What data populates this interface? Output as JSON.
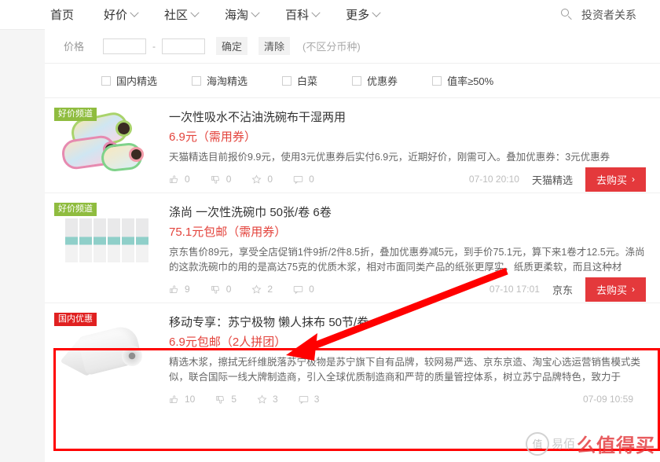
{
  "nav": {
    "items": [
      {
        "label": "首页",
        "caret": false
      },
      {
        "label": "好价",
        "caret": true
      },
      {
        "label": "社区",
        "caret": true
      },
      {
        "label": "海淘",
        "caret": true
      },
      {
        "label": "百科",
        "caret": true
      },
      {
        "label": "更多",
        "caret": true
      }
    ],
    "search_icon": "search-icon",
    "investor_label": "投资者关系"
  },
  "filters": {
    "price_label": "价格",
    "min_value": "",
    "max_value": "",
    "min_placeholder": "",
    "max_placeholder": "",
    "dash": "-",
    "confirm_label": "确定",
    "clear_label": "清除",
    "currency_hint": "(不区分币种)",
    "checkboxes": [
      {
        "label": "国内精选",
        "checked": false
      },
      {
        "label": "海淘精选",
        "checked": false
      },
      {
        "label": "白菜",
        "checked": false
      },
      {
        "label": "优惠券",
        "checked": false
      },
      {
        "label": "值率≥50%",
        "checked": false
      }
    ]
  },
  "items": [
    {
      "badge": "好价频道",
      "badge_color": "#8FBC3F",
      "title": "一次性吸水不沾油洗碗布干湿两用",
      "price": "6.9元（需用券）",
      "desc": "天猫精选目前报价9.9元，使用3元优惠券后实付6.9元，近期好价，刚需可入。叠加优惠券：3元优惠券",
      "stats": {
        "like": "0",
        "dislike": "0",
        "star": "0",
        "comment": "0"
      },
      "time": "07-10 20:10",
      "mall": "天猫精选",
      "buy_label": "去购买"
    },
    {
      "badge": "好价频道",
      "badge_color": "#8FBC3F",
      "title": "涤尚 一次性洗碗巾 50张/卷 6卷",
      "price": "75.1元包邮（需用券）",
      "desc": "京东售价89元，享受全店促销1件9折/2件8.5折，叠加优惠券减5元，到手价75.1元，算下来1卷才12.5元。涤尚的这款洗碗巾的用的是高达75克的优质木浆，相对市面同类产品的纸张更厚实，纸质更柔软，而且这种材",
      "stats": {
        "like": "9",
        "dislike": "0",
        "star": "2",
        "comment": "0"
      },
      "time": "07-10 17:01",
      "mall": "京东",
      "buy_label": "去购买"
    },
    {
      "badge": "国内优惠",
      "badge_color": "#E02020",
      "title": "移动专享：苏宁极物 懒人抹布 50节/卷",
      "price": "6.9元包邮（2人拼团）",
      "desc": "精选木浆，擦拭无纤维脱落苏宁极物是苏宁旗下自有品牌，较网易严选、京东京造、淘宝心选运营销售模式类似，联合国际一线大牌制造商，引入全球优质制造商和严苛的质量管控体系，树立苏宁品牌特色，致力于",
      "stats": {
        "like": "10",
        "dislike": "5",
        "star": "3",
        "comment": "3"
      },
      "time": "07-09 10:59",
      "mall": "",
      "buy_label": ""
    }
  ],
  "annotations": {
    "highlight_color": "#ff0000",
    "arrow_color": "#ff0000"
  },
  "watermark": {
    "logo_char": "值",
    "grey_text": "易佰",
    "red_text": "么值得买"
  }
}
